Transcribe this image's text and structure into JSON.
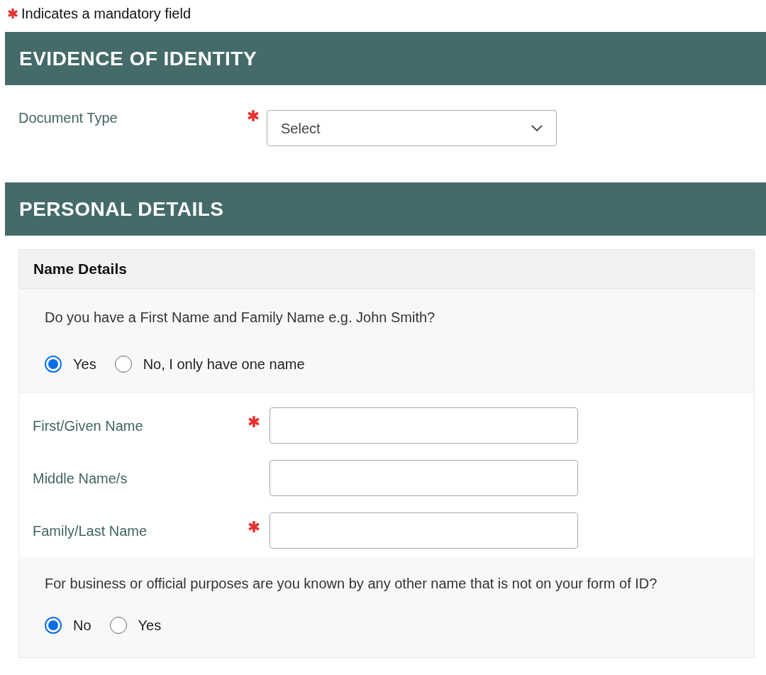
{
  "mandatory_note": {
    "text": "Indicates a mandatory field"
  },
  "evidence": {
    "title": "EVIDENCE OF IDENTITY",
    "document_type": {
      "label": "Document Type",
      "required": true,
      "value": "Select"
    }
  },
  "personal": {
    "title": "PERSONAL DETAILS",
    "card_title": "Name Details",
    "name_question": {
      "text": "Do you have a First Name and Family Name e.g. John Smith?",
      "options": [
        {
          "label": "Yes",
          "selected": true
        },
        {
          "label": "No, I only have one name",
          "selected": false
        }
      ]
    },
    "fields": [
      {
        "label": "First/Given Name",
        "required": true
      },
      {
        "label": "Middle Name/s",
        "required": false
      },
      {
        "label": "Family/Last Name",
        "required": true
      }
    ],
    "other_name_question": {
      "text": "For business or official purposes are you known by any other name that is not on your form of ID?",
      "options": [
        {
          "label": "No",
          "selected": true
        },
        {
          "label": "Yes",
          "selected": false
        }
      ]
    }
  }
}
